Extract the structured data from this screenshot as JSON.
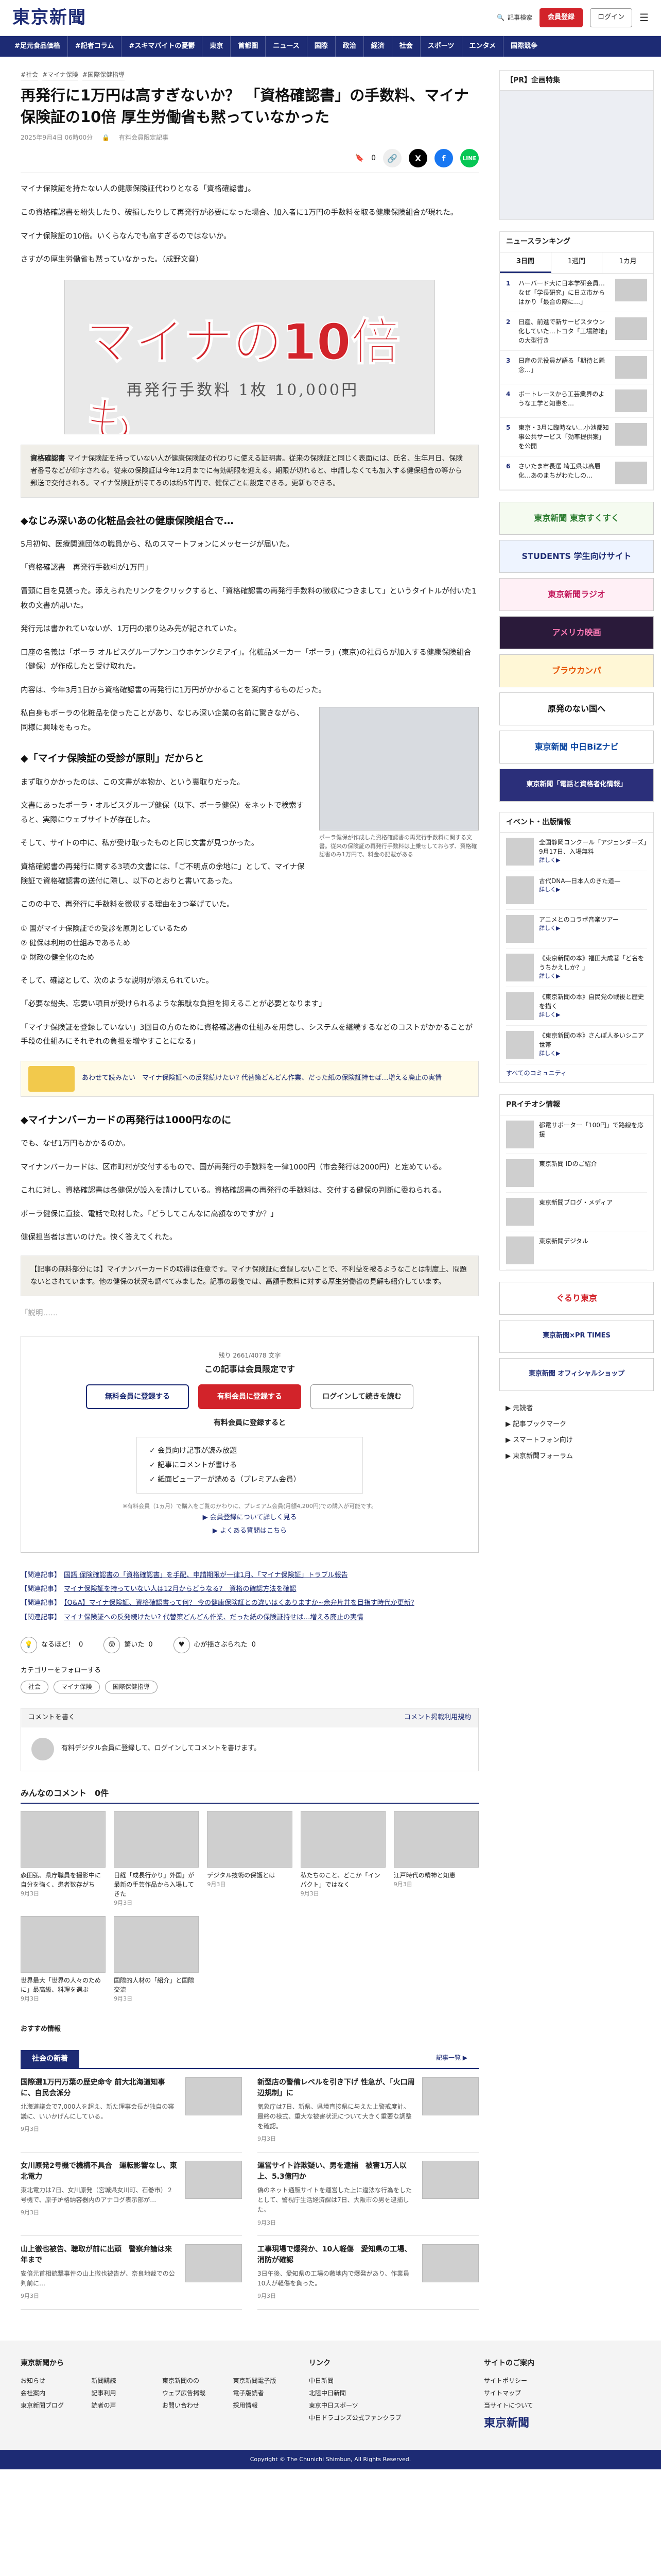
{
  "header": {
    "logo": "東京新聞",
    "search": "記事検索",
    "register": "会員登録",
    "login": "ログイン",
    "menu": "メニュー"
  },
  "nav": [
    "#足元食品価格",
    "#記者コラム",
    "#スキマバイトの憂鬱",
    "東京",
    "首都圏",
    "ニュース",
    "国際",
    "政治",
    "経済",
    "社会",
    "スポーツ",
    "エンタメ",
    "国際競争"
  ],
  "article": {
    "tags": [
      "#社会",
      "#マイナ保険",
      "#国際保健指導"
    ],
    "title": "再発行に1万円は高すぎないか？ 「資格確認書」の手数料、マイナ保険証の10倍 厚生労働省も黙っていなかった",
    "date": "2025年9月4日 06時00分",
    "author": "有料会員限定記事",
    "share_count": "0",
    "p1": "マイナ保険証を持たない人の健康保険証代わりとなる「資格確認書」。",
    "p2": "この資格確認書を紛失したり、破損したりして再発行が必要になった場合、加入者に1万円の手数料を取る健康保険組合が現れた。",
    "p3": "マイナ保険証の10倍。いくらなんでも高すぎるのではないか。",
    "p4": "さすがの厚生労働省も黙っていなかった。（成野文音）",
    "hero_text": "マイナの10倍も",
    "hero_doc": "再発行手数料 1枚 10,000円",
    "note_title": "資格確認書",
    "note_text": "マイナ保険証を持っていない人が健康保険証の代わりに使える証明書。従来の保険証と同じく表面には、氏名、生年月日、保険者番号などが印字される。従来の保険証は今年12月までに有効期限を迎える。期限が切れると、申請しなくても加入する健保組合の等から郵送で交付される。マイナ保険証が持てるのは約5年間で、健保ごとに設定できる。更新もできる。",
    "h_a": "◆なじみ深いあの化粧品会社の健康保険組合で…",
    "p5": "5月初旬、医療関連団体の職員から、私のスマートフォンにメッセージが届いた。",
    "p6": "「資格確認書　再発行手数料が1万円」",
    "p7": "冒頭に目を見張った。添えられたリンクをクリックすると、「資格確認書の再発行手数料の徴収につきまして」というタイトルが付いた1枚の文書が開いた。",
    "p8": "発行元は書かれていないが、1万円の振り込み先が記されていた。",
    "p9": "口座の名義は「ポーラ オルビスグループケンコウホケンクミアイ」。化粧品メーカー「ポーラ」(東京)の社員らが加入する健康保険組合（健保）が作成したと受け取れた。",
    "p10": "内容は、今年3月1日から資格確認書の再発行に1万円がかかることを案内するものだった。",
    "p11": "私自身もポーラの化粧品を使ったことがあり、なじみ深い企業の名前に驚きながら、同様に興味をもった。",
    "h_b": "◆「マイナ保険証の受診が原則」だからと",
    "fig_cap": "ポーラ健保が作成した資格確認書の再発行手数料に関する文書。従来の保険証の再発行手数料は上乗せしておらず、資格確認書のみ1万円で、料金の記載がある",
    "p12": "まず取りかかったのは、この文書が本物か、という裏取りだった。",
    "p13": "文書にあったポーラ・オルビスグループ健保（以下、ポーラ健保）をネットで検索すると、実際にウェブサイトが存在した。",
    "p14": "そして、サイトの中に、私が受け取ったものと同じ文書が見つかった。",
    "p15": "資格確認書の再発行に関する3項の文書には、「ご不明点の余地に」として、マイナ保険証で資格確認書の送付に際し、以下のとおりと書いてあった。",
    "p16": "このの中で、再発行に手数料を徴収する理由を3つ挙げていた。",
    "list": [
      "① 国がマイナ保険証での受診を原則としているため",
      "② 健保は利用の仕組みであるため",
      "③ 財政の健全化のため"
    ],
    "p17": "そして、確認として、次のような説明が添えられていた。",
    "p18": "「必要な紛失、忘要い項目が受けられるような無駄な負担を抑えることが必要となります」",
    "p19": "「マイナ保険証を登録していない」3回目の方のために資格確認書の仕組みを用意し、システムを継続するなどのコストがかかることが手段の仕組みにそれぞれの負担を増やすことになる」",
    "ad_banner": "あわせて読みたい　マイナ保険証への反発続けたい? 代替策どんどん作業、だった紙の保険証持せば…増える廃止の実情",
    "h_c": "◆マイナンバーカードの再発行は1000円なのに",
    "p20": "でも、なぜ1万円もかかるのか。",
    "p21": "マイナンバーカードは、区市町村が交付するもので、国が再発行の手数料を一律1000円（市会発行は2000円）と定めている。",
    "p22": "これに対し、資格確認書は各健保が設入を請けしている。資格確認書の再発行の手数料は、交付する健保の判断に委ねられる。",
    "p23": "ポーラ健保に直接、電話で取材した。「どうしてこんなに高額なのですか？」",
    "p24": "健保担当者は言いのけた。快く答えてくれた。",
    "note2": "【記事の無料部分には】マイナンバーカードの取得は任意です。マイナ保険証に登録しないことで、不利益を被るようなことは制度上、問題ないとされています。他の健保の状況も調べてみました。記事の最後では、高額手数料に対する厚生労働省の見解も紹介しています。",
    "cutoff": "「説明……",
    "remaining": "残り 2661/4078 文字",
    "paywall_title": "この記事は会員限定です",
    "pw_free": "無料会員に登録する",
    "pw_paid": "有料会員に登録する",
    "pw_login": "ログインして続きを読む",
    "pw_paid_head": "有料会員に登録すると",
    "benefits": [
      "✓ 会員向け記事が読み放題",
      "✓ 記事にコメントが書ける",
      "✓ 紙面ビューアーが読める（プレミアム会員）"
    ],
    "pw_note": "※有料会員（1ヵ月）で購入をご覧のかわりに、プレミアム会員(月額4,200円)での購入が可能です。",
    "pw_link1": "▶ 会員登録について詳しく見る",
    "pw_link2": "▶ よくある質問はこちら",
    "related": [
      {
        "k": "【関連記事】",
        "t": "国語 保険確認書の「資格確認書」を手配、申請期限が一律1月、「マイナ保険証」トラブル報告"
      },
      {
        "k": "【関連記事】",
        "t": "マイナ保険証を持っていない人は12月からどうなる?　資格の確認方法を確認"
      },
      {
        "k": "【関連記事】",
        "t": "【Q&A】マイナ保険証、資格確認書って何？ 今の健康保険証との違いはくありますか~余弁片井を目指す時代か更新?"
      },
      {
        "k": "【関連記事】",
        "t": "マイナ保険証への反発続けたい? 代替策どんどん作業、だった紙の保険証持せば…増える廃止の実情"
      }
    ],
    "react1": "なるほど！",
    "react1n": "0",
    "react2": "驚いた",
    "react2n": "0",
    "react3": "心が揺さぶられた",
    "react3n": "0",
    "follow": "カテゴリーをフォローする",
    "follow_tags": [
      "社会",
      "マイナ保険",
      "国際保健指導"
    ]
  },
  "comment": {
    "title": "コメントを書く",
    "rule": "コメント掲載利用規約",
    "prompt": "有料デジタル会員に登録して、ログインしてコメントを書けます。"
  },
  "mine": {
    "title": "みんなのコメント",
    "count": "0件"
  },
  "photos": [
    {
      "t": "森田弘、県庁職員を撮影中に自分を強く、患者数存がち",
      "d": "9月3日"
    },
    {
      "t": "日経「成長行かり」外国」が最新の手芸作品から入場してきた",
      "d": "9月3日"
    },
    {
      "t": "デジタル技術の保護とは",
      "d": "9月3日"
    },
    {
      "t": "私たちのこと、どこか「インパクト」ではなく",
      "d": "9月3日"
    },
    {
      "t": "江戸時代の精神と知恵",
      "d": "9月3日"
    },
    {
      "t": "世界最大「世界の人々のために」最高級、料理を選ぶ",
      "d": "9月3日"
    },
    {
      "t": "国際的人材の「紹介」と国際交流",
      "d": "9月3日"
    }
  ],
  "recommend": "おすすめ情報",
  "social": {
    "title": "社会の新着",
    "more": "記事一覧 ▶",
    "items": [
      {
        "t": "国際選1万円万葉の歴史命令 前大北海道知事に、自民会派分",
        "s": "北海道議会で7,000人を超え、新た理事会長が独自の審議に、いいかげんにしている。",
        "d": "9月3日"
      },
      {
        "t": "新型店の警備レベルを引き下げ 性急が、「火口周辺規制」に",
        "s": "気象庁は7日、新県、県境直接県に与えた上警戒度計。最終の様式、重大な被害状況について大きく重要な調整を確認。",
        "d": "9月3日"
      },
      {
        "t": "女川原発2号機で機構不具合　運転影響なし、東北電力",
        "s": "東北電力は7日、女川原発（宮城県女川町、石巻市）２号機で、原子炉格納容器内のアナログ表示部が…",
        "d": "9月3日"
      },
      {
        "t": "運営サイト詐欺疑い、男を逮捕　被害1万人以上、5.3億円か",
        "s": "偽のネット通販サイトを運営した上に違法な行為をしたとして、警視庁生活経済課は7日、大阪市の男を逮捕した。",
        "d": "9月3日"
      },
      {
        "t": "山上徹也被告、聴取が前に出頭　警察弁論は来年まで",
        "s": "安倍元首相銃撃事件の山上徹也被告が、奈良地裁での公判前に…",
        "d": "9月3日"
      },
      {
        "t": "工事現場で爆発か、10人軽傷　愛知県の工場、消防が確認",
        "s": "3日午後、愛知県の工場の敷地内で爆発があり、作業員10人が軽傷を負った。",
        "d": "9月3日"
      }
    ]
  },
  "side": {
    "pr": "【PR】企画特集",
    "ranking": "ニュースランキング",
    "rank_tabs": [
      "3日間",
      "1週間",
      "1カ月"
    ],
    "rank_items": [
      "ハーバード大に日本学研会員…なぜ「学長研究」に日立市からはかり「最合の際に…」",
      "日産、前進で新サービスタウン化していた…トヨタ「工場跡地」の大型行き",
      "日産の元役員が語る「期待と懸念…」",
      "ボートレースから工芸業界のような工学と知恵を…",
      "東京・3月に臨時ない…小池都知事公共サービス「効率提供案」を公開"
    ],
    "rank_more": "さいたま市長選 埼玉県は高層化…あのまちがわたしの…",
    "banners": [
      "東京新聞 東京すくすく",
      "STUDENTS 学生向けサイト",
      "東京新聞ラジオ",
      "アメリカ映画",
      "ブラウカンパ",
      "原発のない国へ",
      "東京新聞 中日BiZナビ",
      "東京新聞「電話と資格者化情報」"
    ],
    "events_title": "イベント・出版情報",
    "events": [
      {
        "t": "全国静岡コンクール「アジェンダーズ」9月17日、入場無料",
        "r": "詳しく▶"
      },
      {
        "t": "古代DNA—日本人のきた道—",
        "r": "詳しく▶"
      },
      {
        "t": "アニメとのコラボ音楽ツアー",
        "r": "詳しく▶"
      },
      {
        "t": "《東京新聞の本》福田大成著「ど名をうちかえしか？」",
        "r": "詳しく▶"
      },
      {
        "t": "《東京新聞の本》自民党の戦後と歴史を描く",
        "r": "詳しく▶"
      },
      {
        "t": "《東京新聞の本》さんぽ人多いシニア世帯",
        "r": "詳しく▶"
      }
    ],
    "mobile": "すべてのコミュニティ",
    "pr2": "PRイチオシ情報",
    "pr2_items": [
      "都電サポーター「100円」で路線を応援",
      "東京新聞 IDのご紹介",
      "東京新聞ブログ・メディア",
      "東京新聞デジタル"
    ],
    "banner2": [
      "ぐるり東京",
      "東京新聞×PR TIMES",
      "東京新聞 オフィシャルショップ"
    ],
    "links": [
      "▶ 元読者",
      "▶ 記事ブックマーク",
      "▶ スマートフォン向け",
      "▶ 東京新聞フォーラム"
    ]
  },
  "footer": {
    "c1_title": "東京新聞から",
    "c1": [
      "お知らせ",
      "新聞購読",
      "東京新聞のの",
      "東京新聞電子版",
      "会社案内",
      "記事利用",
      "ウェブ広告掲載",
      "電子版読者",
      "東京新聞ブログ",
      "読者の声",
      "お問い合わせ",
      "採用情報"
    ],
    "c2_title": "リンク",
    "c2": [
      "中日新聞",
      "北陸中日新聞",
      "東京中日スポーツ",
      "中日ドラゴンズ公式ファンクラブ"
    ],
    "c3_title": "サイトのご案内",
    "c3": [
      "サイトポリシー",
      "サイトマップ",
      "当サイトについて"
    ],
    "copy": "Copyright © The Chunichi Shimbun, All Rights Reserved."
  }
}
